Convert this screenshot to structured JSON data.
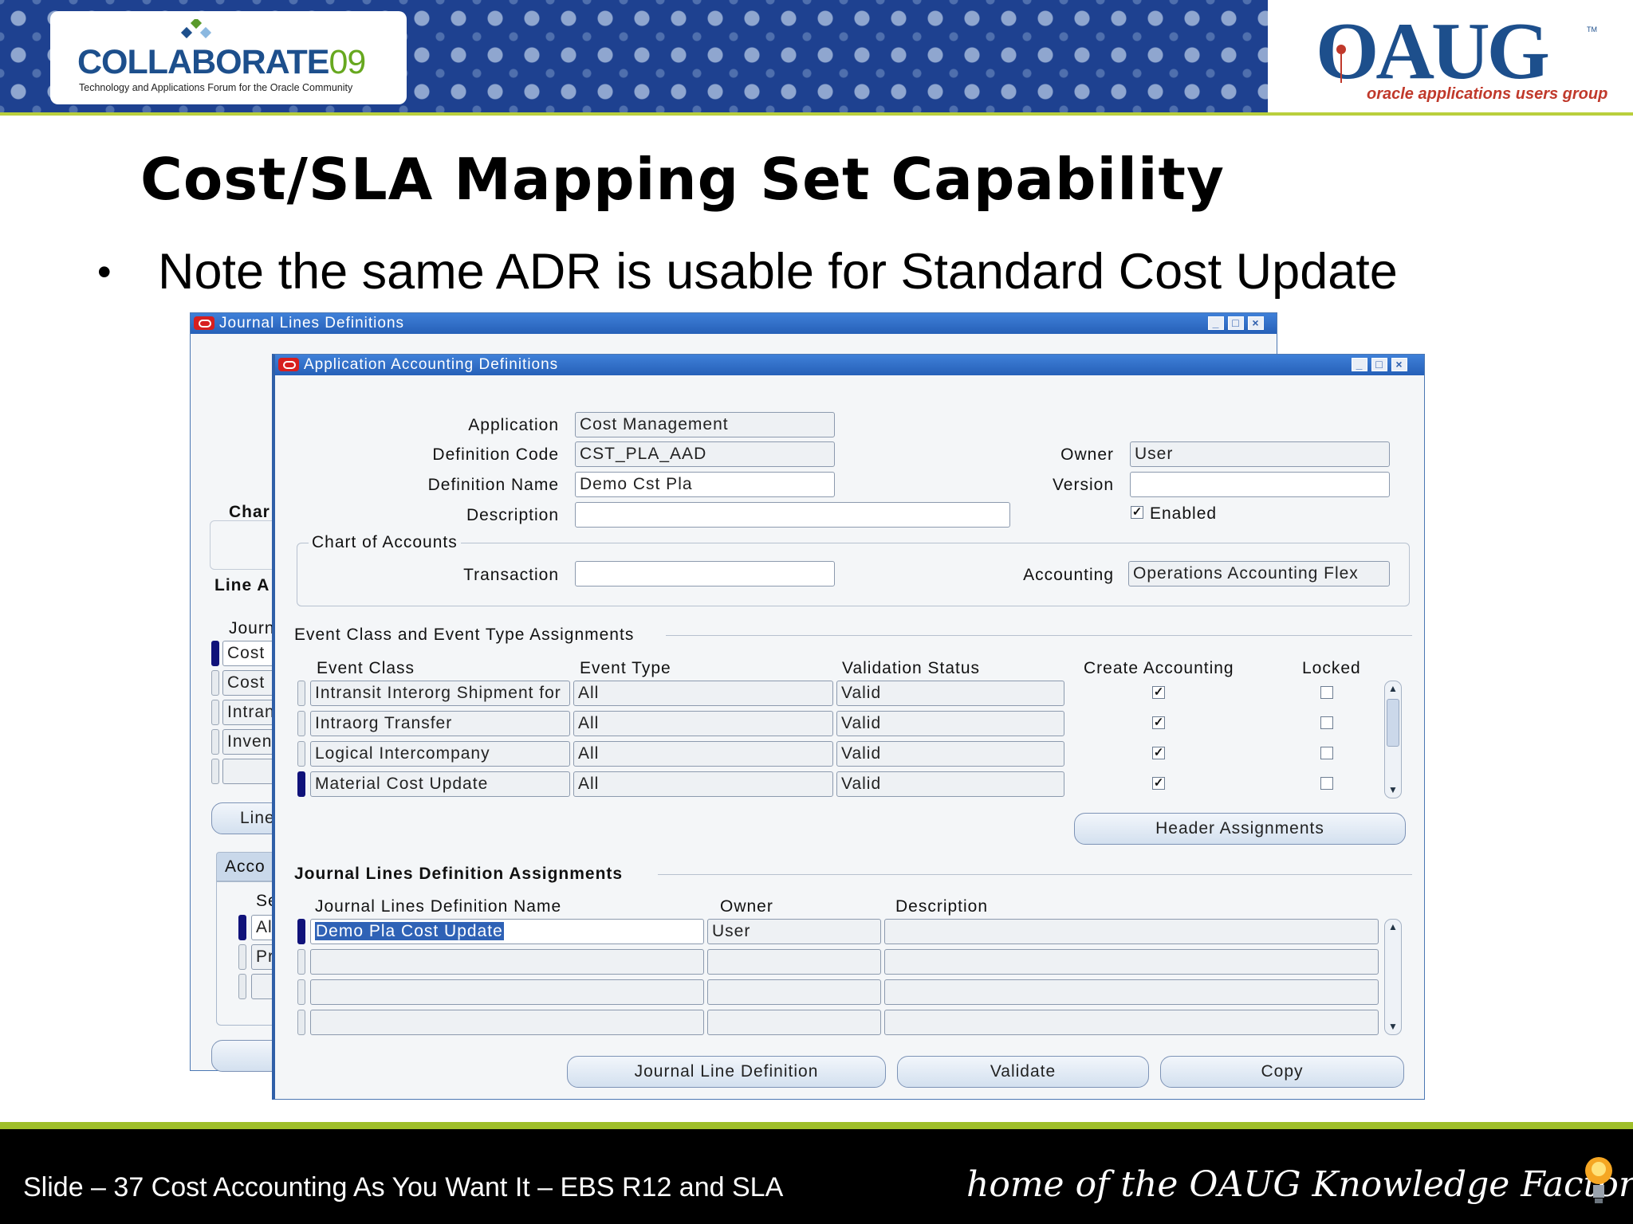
{
  "banner": {
    "collaborate_name": "COLLABORATE",
    "collaborate_year": "09",
    "collaborate_sub": "Technology and Applications Forum for the Oracle Community",
    "oaug_logo": "OAUG",
    "oaug_tm": "TM",
    "oaug_tagline": "oracle applications users group"
  },
  "slide": {
    "title": "Cost/SLA Mapping Set Capability",
    "bullet": "Note the same ADR is usable for Standard Cost Update"
  },
  "bg_window": {
    "title": "Journal Lines Definitions",
    "partial_labels": [
      "Char",
      "Line A",
      "Journ",
      "Cost",
      "Cost",
      "Intran",
      "Invent",
      "Line",
      "Acco",
      "Se",
      "Al",
      "Pr"
    ]
  },
  "aad_window": {
    "title": "Application Accounting Definitions",
    "labels": {
      "application": "Application",
      "definition_code": "Definition Code",
      "definition_name": "Definition Name",
      "description": "Description",
      "owner": "Owner",
      "version": "Version",
      "enabled": "Enabled",
      "chart_of_accounts": "Chart of Accounts",
      "transaction": "Transaction",
      "accounting": "Accounting"
    },
    "values": {
      "application": "Cost Management",
      "definition_code": "CST_PLA_AAD",
      "definition_name": "Demo Cst Pla",
      "description": "",
      "owner": "User",
      "version": "",
      "enabled": true,
      "transaction": "",
      "accounting": "Operations Accounting Flex"
    },
    "event_section": {
      "title": "Event Class and Event Type Assignments",
      "columns": [
        "Event Class",
        "Event Type",
        "Validation Status",
        "Create Accounting",
        "Locked"
      ],
      "rows": [
        {
          "event_class": "Intransit Interorg Shipment for",
          "event_type": "All",
          "status": "Valid",
          "create_accounting": true,
          "locked": false
        },
        {
          "event_class": "Intraorg Transfer",
          "event_type": "All",
          "status": "Valid",
          "create_accounting": true,
          "locked": false
        },
        {
          "event_class": "Logical Intercompany",
          "event_type": "All",
          "status": "Valid",
          "create_accounting": true,
          "locked": false
        },
        {
          "event_class": "Material Cost Update",
          "event_type": "All",
          "status": "Valid",
          "create_accounting": true,
          "locked": false
        }
      ],
      "header_assignments_button": "Header Assignments"
    },
    "jld_section": {
      "title": "Journal Lines Definition Assignments",
      "columns": [
        "Journal Lines Definition Name",
        "Owner",
        "Description"
      ],
      "rows": [
        {
          "name": "Demo Pla Cost Update",
          "owner": "User",
          "description": ""
        },
        {
          "name": "",
          "owner": "",
          "description": ""
        },
        {
          "name": "",
          "owner": "",
          "description": ""
        },
        {
          "name": "",
          "owner": "",
          "description": ""
        }
      ]
    },
    "buttons": {
      "journal_line_definition": "Journal Line Definition",
      "validate": "Validate",
      "copy": "Copy"
    }
  },
  "footer": {
    "text": "Slide – 37 Cost Accounting As You Want It – EBS R12 and SLA",
    "knowledge": "home of the OAUG Knowledge Factory"
  },
  "colors": {
    "banner_blue": "#1e4190",
    "accent_green": "#9fbf2a",
    "titlebar_blue": "#2e6cc4",
    "oaug_red": "#c0392b"
  }
}
